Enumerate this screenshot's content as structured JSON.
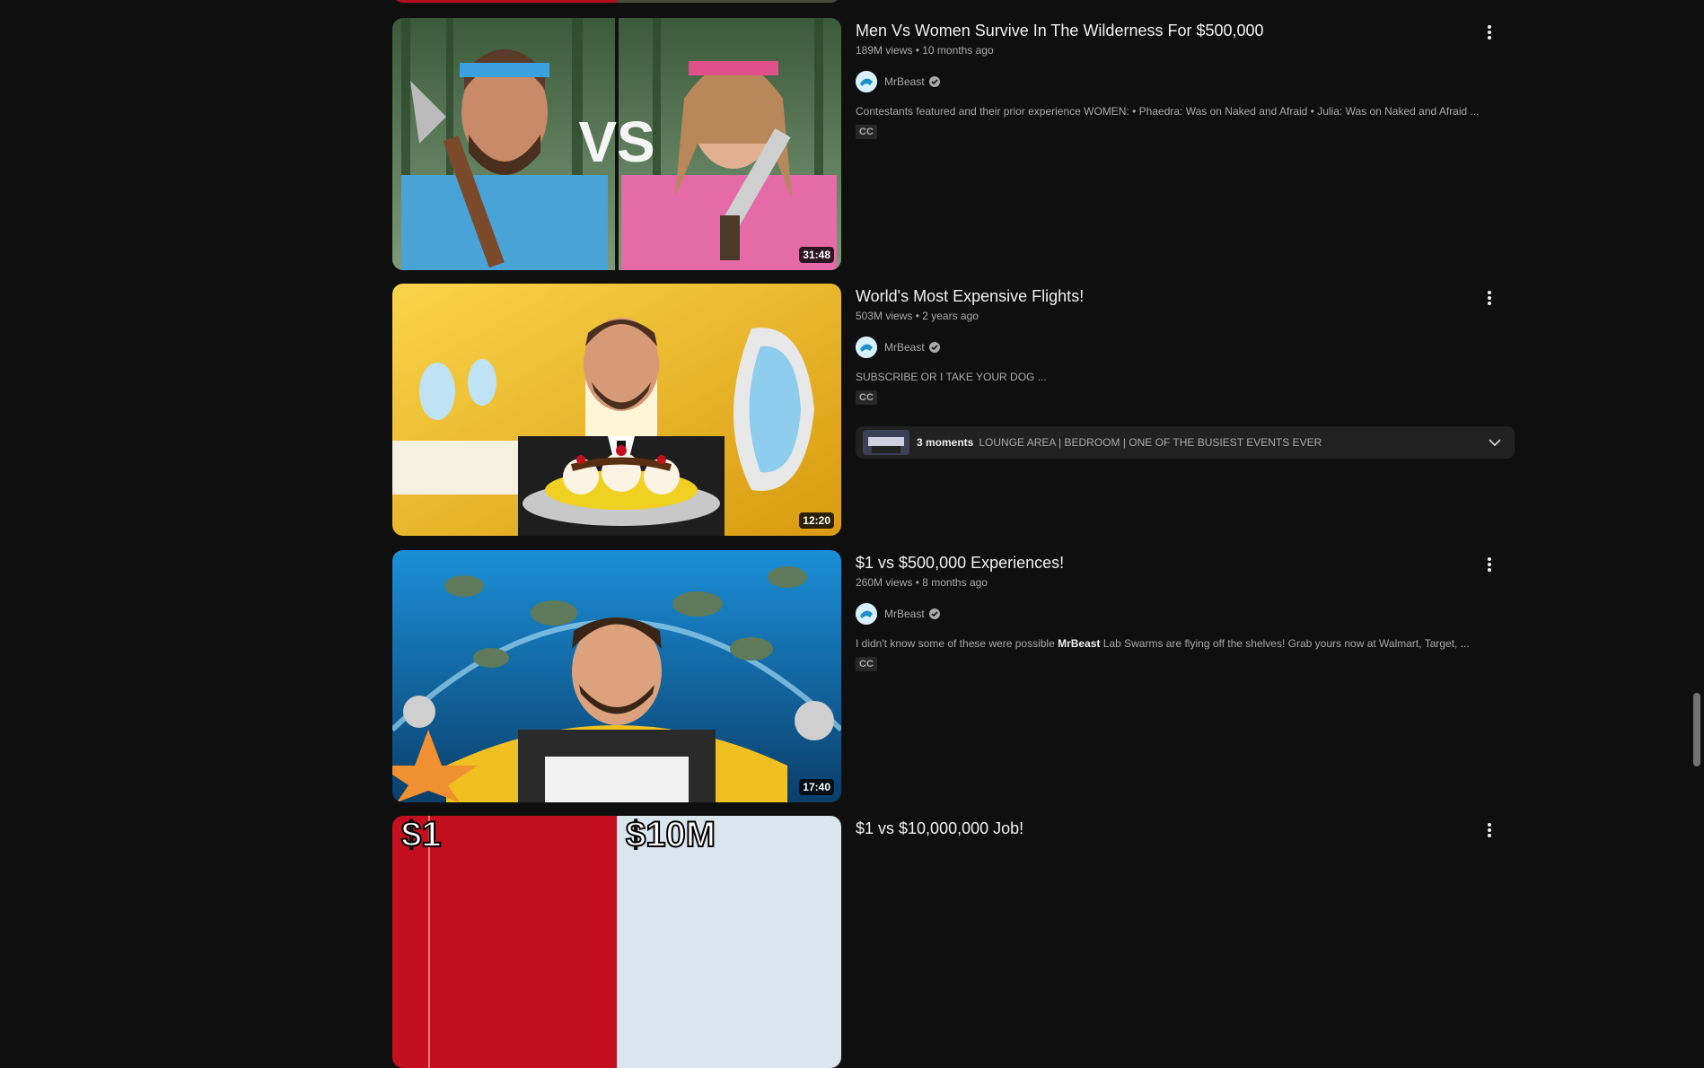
{
  "videos": [
    {
      "title": "Men Vs Women Survive In The Wilderness For $500,000",
      "views": "189M views",
      "age": "10 months ago",
      "meta_sep": "•",
      "channel": "MrBeast",
      "description": "Contestants featured and their prior experience WOMEN: • Phaedra: Was on Naked and Afraid • Julia: Was on Naked and Afraid ...",
      "badge": "CC",
      "duration": "31:48"
    },
    {
      "title": "World's Most Expensive Flights!",
      "views": "503M views",
      "age": "2 years ago",
      "meta_sep": "•",
      "channel": "MrBeast",
      "description": "SUBSCRIBE OR I TAKE YOUR DOG ...",
      "badge": "CC",
      "duration": "12:20",
      "moments": {
        "count": "3 moments",
        "chapters": "LOUNGE AREA | BEDROOM | ONE OF THE BUSIEST EVENTS EVER"
      }
    },
    {
      "title": "$1 vs $500,000 Experiences!",
      "views": "260M views",
      "age": "8 months ago",
      "meta_sep": "•",
      "channel": "MrBeast",
      "description_pre": "I didn't know some of these were possible ",
      "description_bold": "MrBeast",
      "description_post": " Lab Swarms are flying off the shelves! Grab yours now at Walmart, Target, ...",
      "badge": "CC",
      "duration": "17:40"
    },
    {
      "title": "$1 vs $10,000,000 Job!",
      "thumb_text_left": "$1",
      "thumb_text_right": "$10M"
    }
  ],
  "icons": {
    "menu": "more-vert-icon",
    "verified": "verified-check-icon",
    "chevron": "chevron-down-icon"
  },
  "colors": {
    "background": "#0f0f0f",
    "text_primary": "#f1f1f1",
    "text_secondary": "#aaaaaa"
  }
}
